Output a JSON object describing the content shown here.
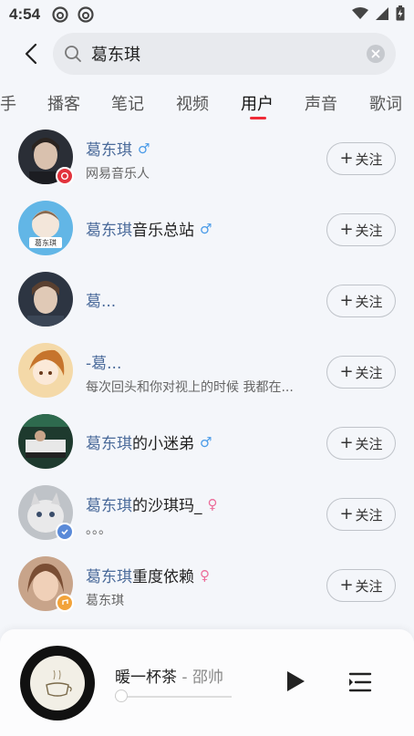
{
  "status_bar": {
    "time": "4:54"
  },
  "search": {
    "query": "葛东琪",
    "placeholder": ""
  },
  "tabs": [
    {
      "label": "手"
    },
    {
      "label": "播客"
    },
    {
      "label": "笔记"
    },
    {
      "label": "视频"
    },
    {
      "label": "用户",
      "active": true
    },
    {
      "label": "声音"
    },
    {
      "label": "歌词"
    }
  ],
  "follow_label": "关注",
  "follow_plus": "+",
  "users": [
    {
      "name_hl": "葛东琪",
      "name_rest": "",
      "gender": "male",
      "subtitle": "网易音乐人",
      "badge": "red"
    },
    {
      "name_hl": "葛东琪",
      "name_rest": "音乐总站",
      "gender": "male",
      "subtitle": "",
      "badge": ""
    },
    {
      "name_hl": "葛...",
      "name_rest": "",
      "gender": "",
      "subtitle": "",
      "badge": ""
    },
    {
      "name_hl": "-葛...",
      "name_rest": "",
      "gender": "",
      "subtitle": "每次回头和你对视上的时候 我都在...",
      "badge": ""
    },
    {
      "name_hl": "葛东琪",
      "name_rest": "的小迷弟",
      "gender": "male",
      "subtitle": "",
      "badge": ""
    },
    {
      "name_hl": "葛东琪",
      "name_rest": "的沙琪玛_",
      "gender": "female",
      "subtitle": "。。。",
      "badge": ""
    },
    {
      "name_hl": "葛东琪",
      "name_rest": "重度依赖",
      "gender": "female",
      "subtitle": "葛东琪",
      "badge": "orange"
    }
  ],
  "player": {
    "title": "暖一杯茶",
    "artist": " - 邵帅",
    "progress": 0.0
  },
  "colors": {
    "accent": "#ef2a37",
    "highlight": "#4a6a9a"
  }
}
